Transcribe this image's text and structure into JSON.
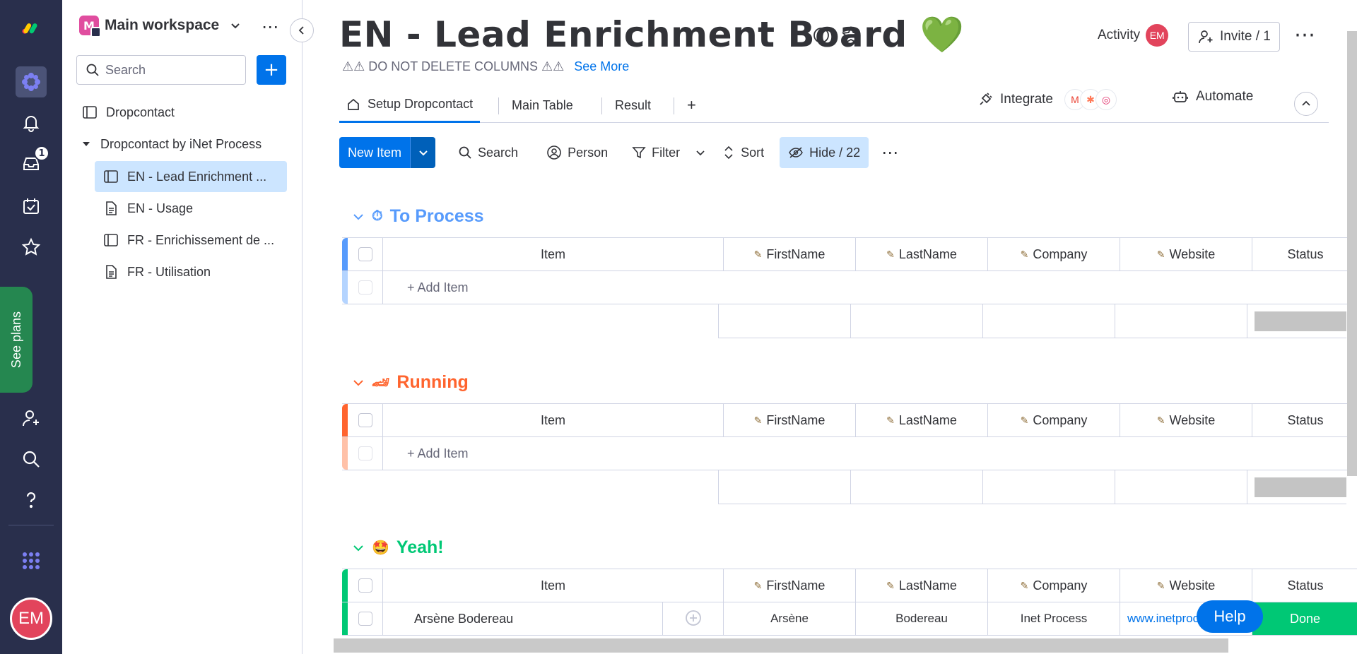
{
  "colors": {
    "rail": "#292f4c",
    "primary": "#0073ea",
    "to_process": "#579bfc",
    "running": "#ff642e",
    "yeah": "#00c875",
    "done": "#00c875"
  },
  "rail": {
    "notifications_badge": "1",
    "see_plans": "See plans",
    "avatar": "EM"
  },
  "sidebar": {
    "workspace_logo": "M",
    "workspace_name": "Main workspace",
    "search_placeholder": "Search",
    "add_label": "+",
    "items": [
      {
        "label": "Dropcontact",
        "icon": "board-icon"
      },
      {
        "label": "Dropcontact by iNet Process",
        "icon": "folder-caret-icon"
      },
      {
        "label": "EN - Lead Enrichment ...",
        "icon": "board-icon",
        "selected": true
      },
      {
        "label": "EN - Usage",
        "icon": "doc-icon"
      },
      {
        "label": "FR - Enrichissement de ...",
        "icon": "board-icon"
      },
      {
        "label": "FR - Utilisation",
        "icon": "doc-icon"
      }
    ]
  },
  "header": {
    "title": "EN - Lead Enrichment Board 💚",
    "subtitle": "⚠⚠ DO NOT DELETE COLUMNS ⚠⚠",
    "see_more": "See More",
    "activity": "Activity",
    "activity_avatar": "EM",
    "invite": "Invite / 1"
  },
  "tabs": [
    {
      "label": "Setup Dropcontact",
      "active": true
    },
    {
      "label": "Main Table"
    },
    {
      "label": "Result"
    }
  ],
  "tab_add": "+",
  "integrate": "Integrate",
  "automate": "Automate",
  "toolbar": {
    "new_item": "New Item",
    "search": "Search",
    "person": "Person",
    "filter": "Filter",
    "sort": "Sort",
    "hide": "Hide / 22"
  },
  "columns": {
    "item": "Item",
    "firstname": "FirstName",
    "lastname": "LastName",
    "company": "Company",
    "website": "Website",
    "status": "Status"
  },
  "groups": [
    {
      "title": "To Process",
      "emoji": "⏱",
      "add_item": "+ Add Item"
    },
    {
      "title": "Running",
      "emoji": "🏎",
      "add_item": "+ Add Item"
    },
    {
      "title": "Yeah!",
      "emoji": "🤩"
    }
  ],
  "yeah_row": {
    "item": "Arsène Bodereau",
    "firstname": "Arsène",
    "lastname": "Bodereau",
    "company": "Inet Process",
    "website": "www.inetprocess",
    "status": "Done"
  },
  "help": "Help"
}
